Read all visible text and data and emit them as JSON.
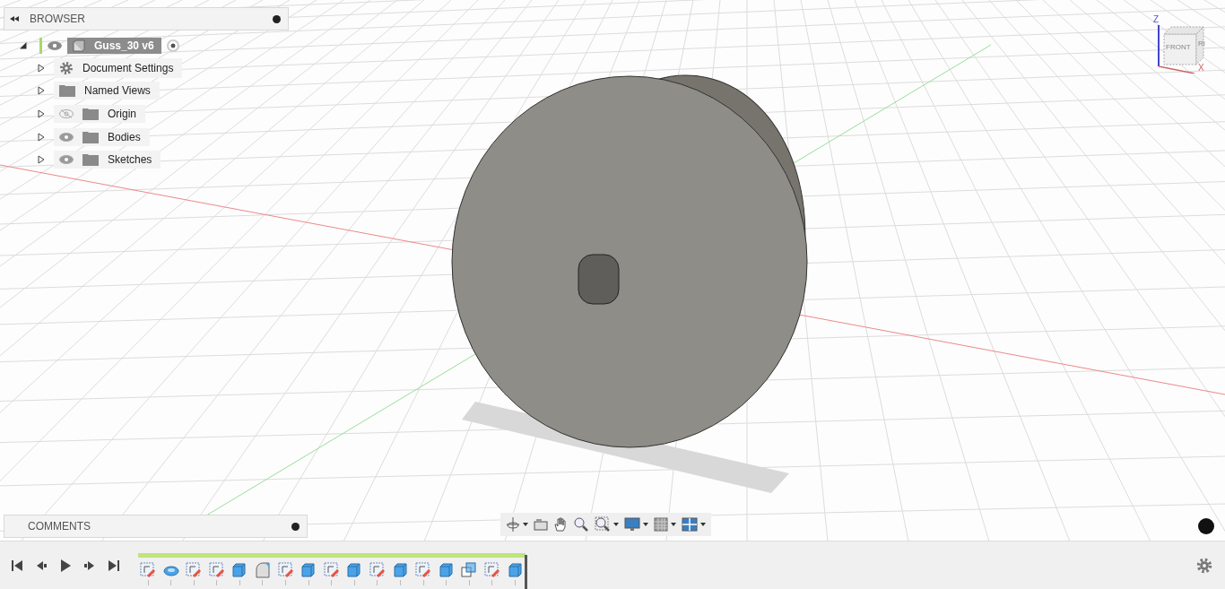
{
  "browser": {
    "title": "BROWSER",
    "root": {
      "label": "Guss_30 v6",
      "expanded": true,
      "visible": true,
      "active": true,
      "activated": true,
      "children": [
        {
          "label": "Document Settings",
          "kind": "settings",
          "expanded": false
        },
        {
          "label": "Named Views",
          "kind": "folder",
          "expanded": false
        },
        {
          "label": "Origin",
          "kind": "folder",
          "expanded": false,
          "visible": false
        },
        {
          "label": "Bodies",
          "kind": "folder",
          "expanded": false,
          "visible": true
        },
        {
          "label": "Sketches",
          "kind": "folder",
          "expanded": false,
          "visible": true
        }
      ]
    }
  },
  "viewcube": {
    "face_front": "FRONT",
    "face_right": "RI",
    "axis_z": "Z",
    "axis_x": "X"
  },
  "comments": {
    "title": "COMMENTS"
  },
  "timeline": {
    "level": 1,
    "features": [
      {
        "kind": "sketch"
      },
      {
        "kind": "revolve"
      },
      {
        "kind": "sketch"
      },
      {
        "kind": "sketch"
      },
      {
        "kind": "extrude"
      },
      {
        "kind": "fillet"
      },
      {
        "kind": "sketch"
      },
      {
        "kind": "extrude"
      },
      {
        "kind": "sketch"
      },
      {
        "kind": "extrude"
      },
      {
        "kind": "sketch"
      },
      {
        "kind": "extrude"
      },
      {
        "kind": "sketch"
      },
      {
        "kind": "extrude"
      },
      {
        "kind": "combine"
      },
      {
        "kind": "sketch"
      },
      {
        "kind": "extrude"
      }
    ]
  }
}
